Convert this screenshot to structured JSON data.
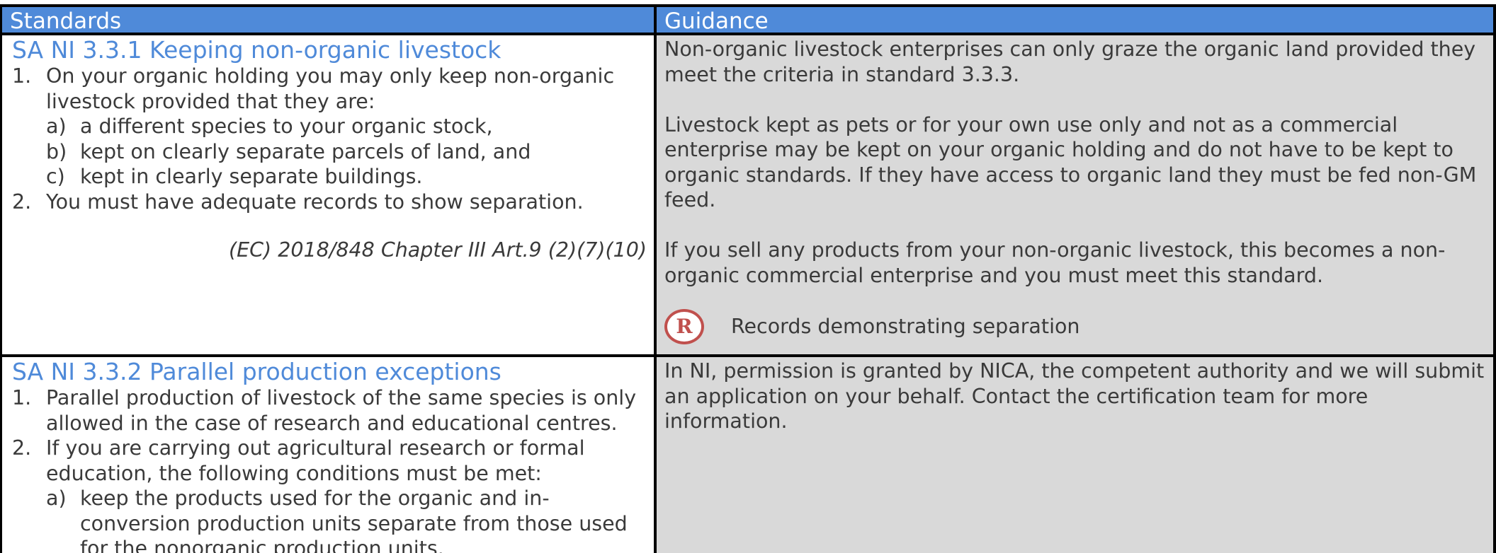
{
  "header": {
    "standards": "Standards",
    "guidance": "Guidance"
  },
  "sections": [
    {
      "title": "SA NI 3.3.1 Keeping non-organic livestock",
      "items": [
        {
          "num": "1.",
          "text": "On your organic holding you may only keep non-organic livestock provided that they are:",
          "subitems": [
            {
              "letter": "a)",
              "text": "a different species to your organic stock,"
            },
            {
              "letter": "b)",
              "text": "kept on clearly separate parcels of land, and"
            },
            {
              "letter": "c)",
              "text": "kept in clearly separate buildings."
            }
          ]
        },
        {
          "num": "2.",
          "text": "You must have adequate records to show separation."
        }
      ],
      "reference": "(EC) 2018/848 Chapter III Art.9 (2)(7)(10)",
      "guidance": [
        "Non-organic livestock enterprises can only graze the organic land provided they meet the criteria in standard 3.3.3.",
        "Livestock kept as pets or for your own use only and not as a commercial enterprise may be kept on your organic holding and do not have to be kept to organic standards. If they have access to organic land they must be fed non-GM feed.",
        "If you sell any products from your non-organic livestock, this becomes a non-organic commercial enterprise and you must meet this standard."
      ],
      "records_icon_letter": "R",
      "records_icon_color": "#c0504d",
      "records_text": "Records demonstrating separation"
    },
    {
      "title": "SA NI 3.3.2 Parallel production exceptions",
      "items": [
        {
          "num": "1.",
          "text": "Parallel production of livestock of the same species is only allowed in the case of research and educational centres."
        },
        {
          "num": "2.",
          "text": "If you are carrying out agricultural research or formal education, the following conditions must be met:",
          "subitems": [
            {
              "letter": "a)",
              "text": "keep the products used for the organic and in-conversion production units separate from those used for the nonorganic production units."
            }
          ]
        }
      ],
      "guidance": [
        "In NI, permission is granted by NICA, the competent authority and we will submit an application on your behalf. Contact the certification team for more information."
      ]
    }
  ],
  "colors": {
    "header_bg": "#4f8ad9",
    "title_color": "#4f8ad9",
    "guidance_bg": "#d9d9d9"
  }
}
